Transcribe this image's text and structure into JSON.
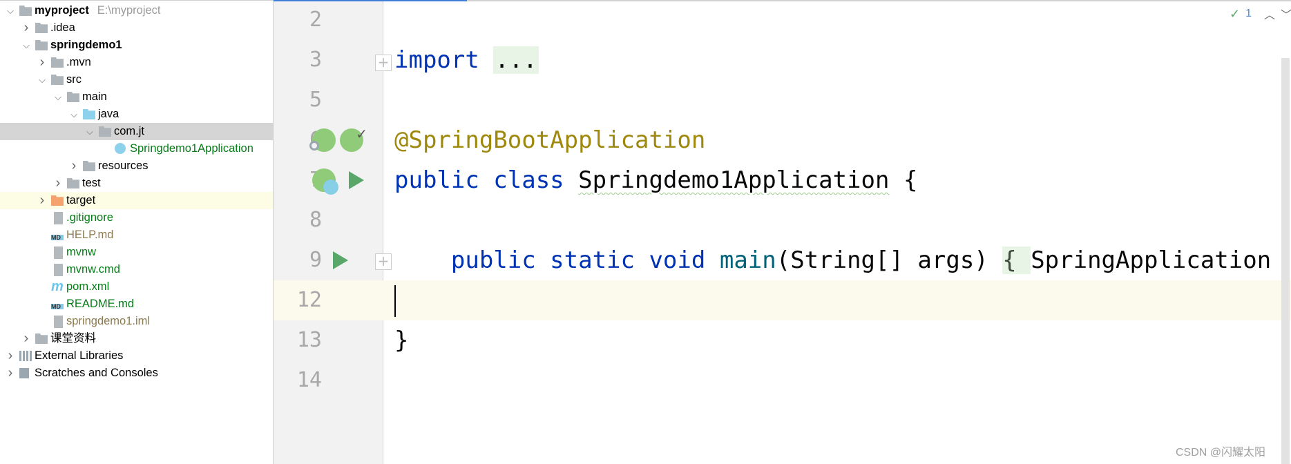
{
  "project_tree": {
    "rows": [
      {
        "label": "myproject",
        "hint": "E:\\myproject",
        "level": 0,
        "expanded": true,
        "bold": true,
        "icon": "module-folder-icon"
      },
      {
        "label": ".idea",
        "level": 1,
        "expanded": false,
        "icon": "folder-icon"
      },
      {
        "label": "springdemo1",
        "level": 1,
        "expanded": true,
        "bold": true,
        "icon": "module-folder-icon"
      },
      {
        "label": ".mvn",
        "level": 2,
        "expanded": false,
        "icon": "folder-icon"
      },
      {
        "label": "src",
        "level": 2,
        "expanded": true,
        "icon": "folder-icon"
      },
      {
        "label": "main",
        "level": 3,
        "expanded": true,
        "icon": "folder-icon"
      },
      {
        "label": "java",
        "level": 4,
        "expanded": true,
        "icon": "source-folder-icon"
      },
      {
        "label": "com.jt",
        "level": 5,
        "expanded": true,
        "icon": "package-icon",
        "selected": true
      },
      {
        "label": "Springdemo1Application",
        "level": 6,
        "icon": "spring-boot-class-icon",
        "color": "#067d17"
      },
      {
        "label": "resources",
        "level": 4,
        "expanded": false,
        "icon": "resources-folder-icon"
      },
      {
        "label": "test",
        "level": 3,
        "expanded": false,
        "icon": "folder-icon"
      },
      {
        "label": "target",
        "level": 2,
        "expanded": false,
        "icon": "excluded-folder-icon",
        "highlighted": true
      },
      {
        "label": ".gitignore",
        "level": 2,
        "icon": "gitignore-file-icon",
        "color": "#067d17"
      },
      {
        "label": "HELP.md",
        "level": 2,
        "icon": "markdown-file-icon",
        "color": "#8c7b4e"
      },
      {
        "label": "mvnw",
        "level": 2,
        "icon": "shell-script-icon",
        "color": "#067d17"
      },
      {
        "label": "mvnw.cmd",
        "level": 2,
        "icon": "text-file-icon",
        "color": "#067d17"
      },
      {
        "label": "pom.xml",
        "level": 2,
        "icon": "maven-icon",
        "color": "#067d17"
      },
      {
        "label": "README.md",
        "level": 2,
        "icon": "markdown-file-icon",
        "color": "#067d17"
      },
      {
        "label": "springdemo1.iml",
        "level": 2,
        "icon": "iml-file-icon",
        "color": "#8c7b4e"
      },
      {
        "label": "课堂资料",
        "level": 1,
        "expanded": false,
        "icon": "folder-icon"
      },
      {
        "label": "External Libraries",
        "level": 0,
        "expanded": false,
        "icon": "libraries-icon"
      },
      {
        "label": "Scratches and Consoles",
        "level": 0,
        "expanded": false,
        "icon": "scratches-icon"
      }
    ]
  },
  "editor": {
    "line_numbers": [
      "2",
      "3",
      "5",
      "6",
      "7",
      "8",
      "9",
      "12",
      "13",
      "14"
    ],
    "code": {
      "l3_kw": "import",
      "l3_fold": "...",
      "l6_annotation": "@SpringBootApplication",
      "l7_kw": "public class",
      "l7_name": "Springdemo1Application",
      "l7_brace": " {",
      "l9_indent": "    ",
      "l9_kw": "public static void",
      "l9_method": "main",
      "l9_params": "(String[] args) ",
      "l9_brace": "{ ",
      "l9_rest": "SpringApplication",
      "l13": "}"
    },
    "inspection_count": "1",
    "current_line": "12"
  },
  "watermark": "CSDN @闪耀太阳",
  "colors": {
    "keyword": "#0033b3",
    "annotation": "#9e880d",
    "method": "#00627a",
    "accent": "#3d7fd6",
    "run": "#59a869"
  }
}
